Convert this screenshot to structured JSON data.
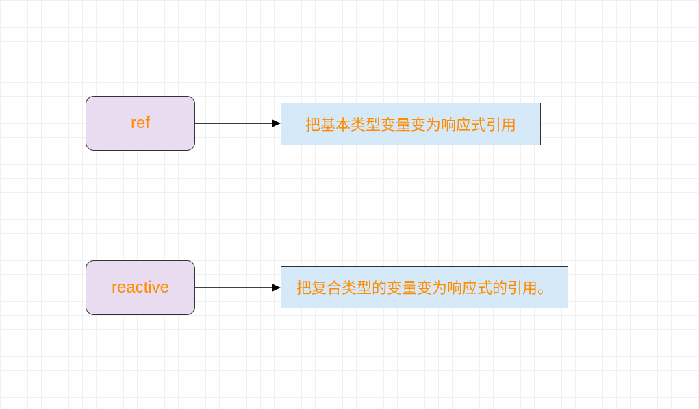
{
  "nodes": {
    "ref": {
      "label": "ref",
      "description": "把基本类型变量变为响应式引用"
    },
    "reactive": {
      "label": "reactive",
      "description": "把复合类型的变量变为响应式的引用。"
    }
  }
}
